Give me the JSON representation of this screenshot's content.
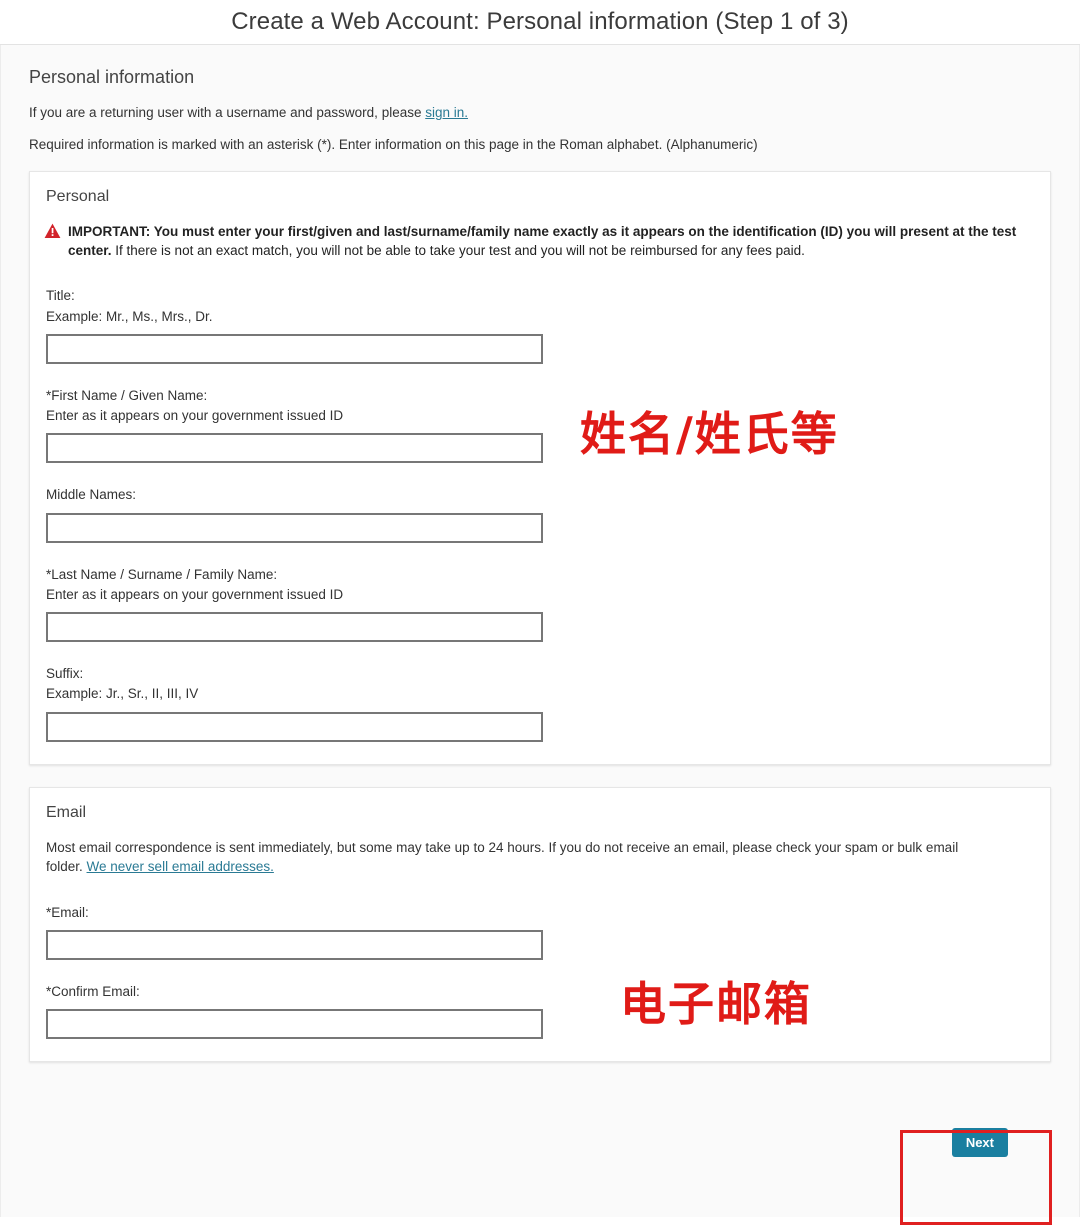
{
  "page": {
    "title": "Create a Web Account: Personal information (Step 1 of 3)",
    "section_heading": "Personal information",
    "intro_line_1_prefix": "If you are a returning user with a username and password, please ",
    "sign_in_link": "sign in.",
    "intro_line_2": "Required information is marked with an asterisk (*). Enter information on this page in the Roman alphabet. (Alphanumeric)"
  },
  "personal_card": {
    "title": "Personal",
    "warning_icon": "warning-triangle-icon",
    "important_bold": "IMPORTANT: You must enter your first/given and last/surname/family name exactly as it appears on the identification (ID) you will present at the test center.",
    "important_rest": " If there is not an exact match, you will not be able to take your test and you will not be reimbursed for any fees paid.",
    "fields": [
      {
        "label": "Title:",
        "hint": "Example: Mr., Ms., Mrs., Dr.",
        "value": "",
        "placeholder": "",
        "name": "title"
      },
      {
        "label": "*First Name / Given Name:",
        "hint": "Enter as it appears on your government issued ID",
        "value": "",
        "placeholder": "",
        "name": "first-name"
      },
      {
        "label": "Middle Names:",
        "hint": "",
        "value": "",
        "placeholder": "",
        "name": "middle-names"
      },
      {
        "label": "*Last Name / Surname / Family Name:",
        "hint": "Enter as it appears on your government issued ID",
        "value": "",
        "placeholder": "",
        "name": "last-name"
      },
      {
        "label": "Suffix:",
        "hint": "Example: Jr., Sr., II, III, IV",
        "value": "",
        "placeholder": "",
        "name": "suffix"
      }
    ]
  },
  "email_card": {
    "title": "Email",
    "note_prefix": "Most email correspondence is sent immediately, but some may take up to 24 hours. If you do not receive an email, please check your spam or bulk email folder. ",
    "note_link": "We never sell email addresses.",
    "fields": [
      {
        "label": "*Email:",
        "hint": "",
        "value": "",
        "placeholder": "",
        "name": "email"
      },
      {
        "label": "*Confirm Email:",
        "hint": "",
        "value": "",
        "placeholder": "",
        "name": "confirm-email"
      }
    ]
  },
  "footer": {
    "next_label": "Next"
  },
  "annotations": {
    "name_note": "姓名/姓氏等",
    "email_note": "电子邮箱",
    "color": "#e01b17",
    "highlight_color": "#e02020"
  }
}
